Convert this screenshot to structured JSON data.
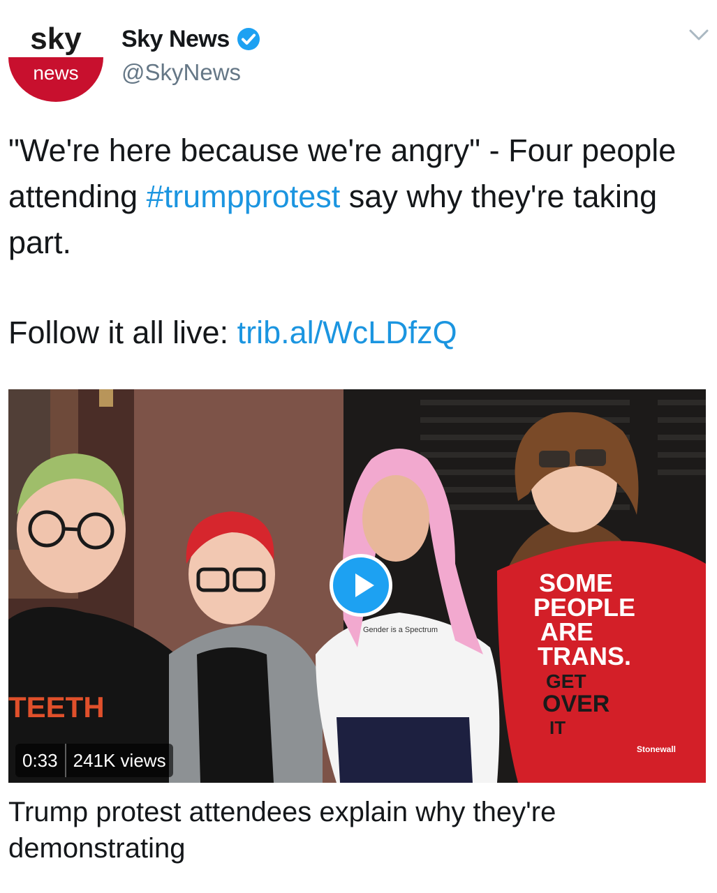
{
  "author": {
    "display_name": "Sky News",
    "handle": "@SkyNews",
    "verified": true,
    "avatar_logo": {
      "top": "sky",
      "bottom": "news"
    }
  },
  "tweet": {
    "text_before": "\"We're here because we're angry\" - Four people attending ",
    "hashtag": "#trumpprotest",
    "text_after": " say why they're taking part.",
    "follow_prefix": "Follow it all live: ",
    "follow_link": "trib.al/WcLDfzQ"
  },
  "media": {
    "duration": "0:33",
    "views": "241K views",
    "shirt_texts": {
      "left_shirt": "TEETH",
      "center_shirt": "Gender is a Spectrum",
      "right_shirt": [
        "SOME",
        "PEOPLE",
        "ARE",
        "TRANS.",
        "GET",
        "OVER",
        "IT"
      ],
      "right_badge": "Stonewall"
    }
  },
  "card": {
    "title": "Trump protest attendees explain why they're demonstrating"
  },
  "icons": {
    "menu": "chevron-down-icon",
    "verified": "verified-badge-icon",
    "play": "play-icon"
  },
  "colors": {
    "link": "#1b95e0",
    "verified": "#1da1f2",
    "sky_red": "#c8102e",
    "handle": "#657786"
  }
}
